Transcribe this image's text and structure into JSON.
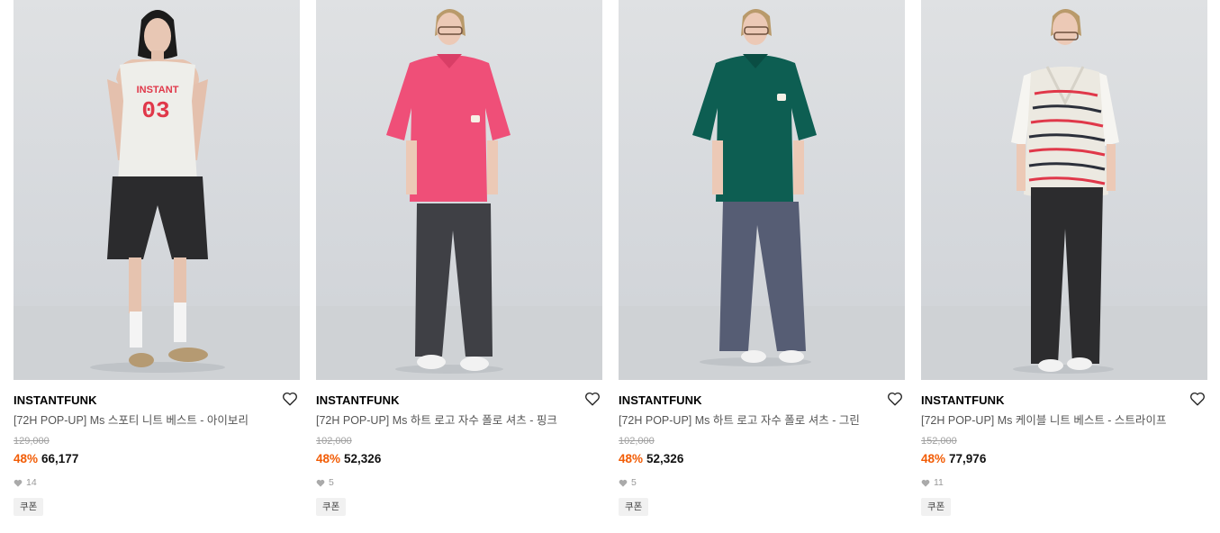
{
  "products": [
    {
      "brand": "INSTANTFUNK",
      "title": "[72H POP-UP] Ms 스포티 니트 베스트 - 아이보리",
      "original_price": "129,000",
      "discount": "48%",
      "price": "66,177",
      "likes": "14",
      "badge": "쿠폰",
      "image_print_line1": "INSTANT",
      "image_print_line2": "03"
    },
    {
      "brand": "INSTANTFUNK",
      "title": "[72H POP-UP] Ms 하트 로고 자수 폴로 셔츠 - 핑크",
      "original_price": "102,000",
      "discount": "48%",
      "price": "52,326",
      "likes": "5",
      "badge": "쿠폰"
    },
    {
      "brand": "INSTANTFUNK",
      "title": "[72H POP-UP] Ms 하트 로고 자수 폴로 셔츠 - 그린",
      "original_price": "102,000",
      "discount": "48%",
      "price": "52,326",
      "likes": "5",
      "badge": "쿠폰"
    },
    {
      "brand": "INSTANTFUNK",
      "title": "[72H POP-UP] Ms 케이블 니트 베스트 - 스트라이프",
      "original_price": "152,000",
      "discount": "48%",
      "price": "77,976",
      "likes": "11",
      "badge": "쿠폰"
    }
  ],
  "colors": {
    "discount": "#f25c05",
    "pink_polo": "#ef4f78",
    "green_polo": "#0d5e52",
    "ivory_vest": "#eeeeea",
    "vest_print": "#e0384a"
  },
  "icons": {
    "wishlist": "heart-outline-icon",
    "likes": "heart-filled-icon"
  }
}
